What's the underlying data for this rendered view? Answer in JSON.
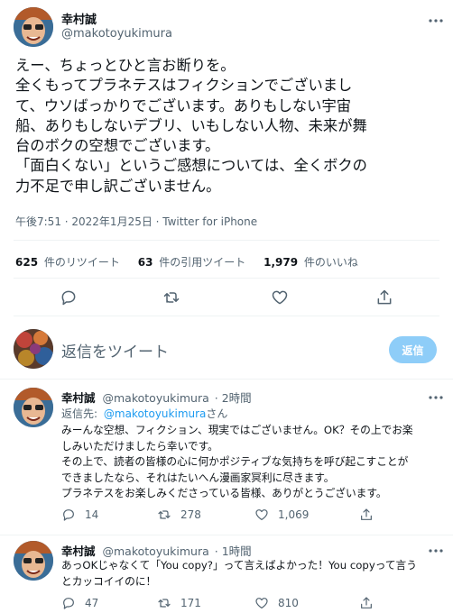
{
  "main_tweet": {
    "display_name": "幸村誠",
    "handle": "@makotoyukimura",
    "lines": [
      "えー、ちょっとひと言お断りを。",
      "全くもってプラネテスはフィクションでございまし",
      "て、ウソばっかりでございます。ありもしない宇宙",
      "船、ありもしないデブリ、いもしない人物、未来が舞",
      "台のボクの空想でございます。",
      "「面白くない」というご感想については、全くボクの",
      "力不足で申し訳ございません。"
    ],
    "timestamp": "午後7:51 · 2022年1月25日 · Twitter for iPhone",
    "stats": {
      "retweets_count": "625",
      "retweets_label": "件のリツイート",
      "quotes_count": "63",
      "quotes_label": "件の引用ツイート",
      "likes_count": "1,979",
      "likes_label": "件のいいね"
    }
  },
  "reply_composer": {
    "placeholder": "返信をツイート",
    "button_label": "返信"
  },
  "replies": [
    {
      "display_name": "幸村誠",
      "handle": "@makotoyukimura",
      "time": "· 2時間",
      "reply_to_prefix": "返信先:",
      "reply_to_handle": "@makotoyukimura",
      "reply_to_suffix": "さん",
      "lines": [
        "みーんな空想、フィクション、現実ではございません。OK？その上でお楽",
        "しみいただけましたら幸いです。",
        "その上で、読者の皆様の心に何かポジティブな気持ちを呼び起こすことが",
        "できましたなら、それはたいへん漫画家冥利に尽きます。",
        "プラネテスをお楽しみくださっている皆様、ありがとうございます。"
      ],
      "replies_count": "14",
      "retweets_count": "278",
      "likes_count": "1,069"
    },
    {
      "display_name": "幸村誠",
      "handle": "@makotoyukimura",
      "time": "· 1時間",
      "lines": [
        "あっOKじゃなくて「You copy?」って言えばよかった！You copyって言う",
        "とカッコイイのに！"
      ],
      "replies_count": "47",
      "retweets_count": "171",
      "likes_count": "810"
    }
  ],
  "colors": {
    "accent": "#1d9bf0",
    "text": "#0f1419",
    "secondary": "#536471"
  }
}
